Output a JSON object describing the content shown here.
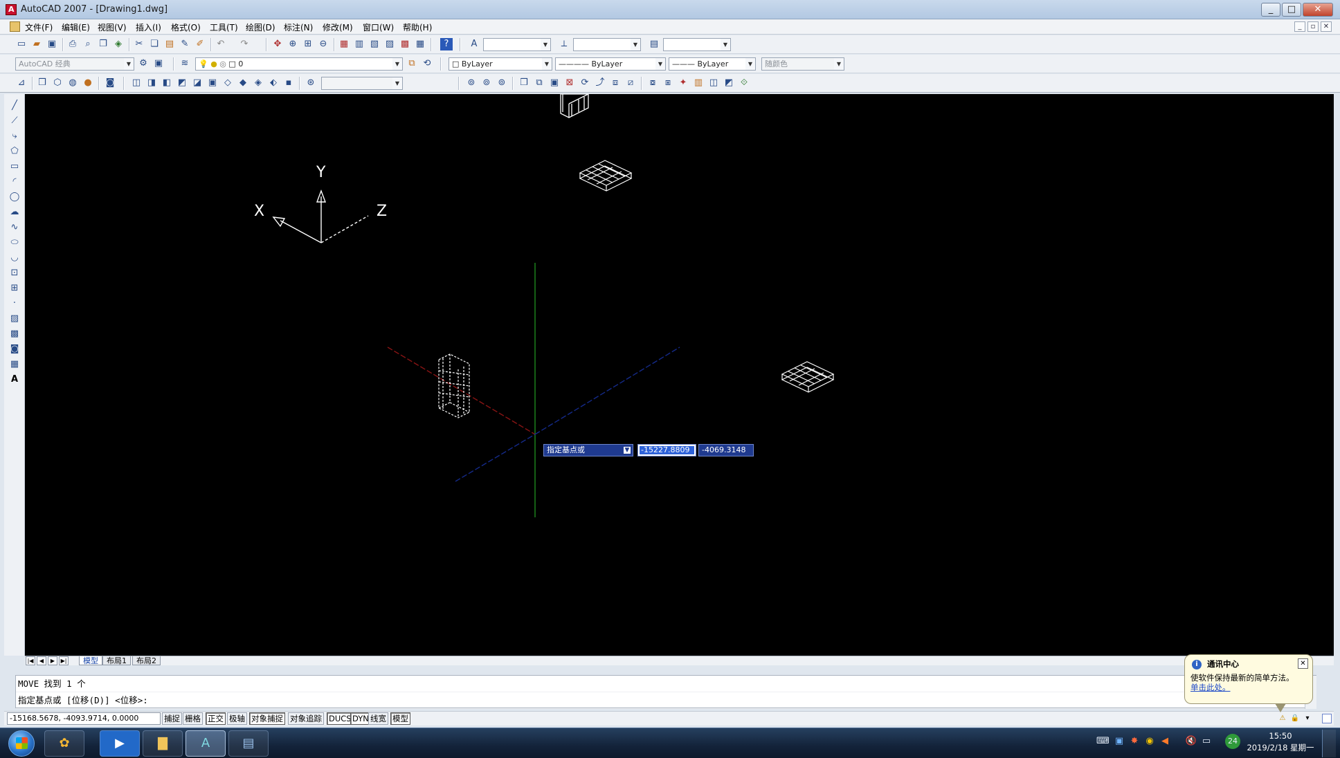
{
  "window": {
    "title": "AutoCAD 2007 - [Drawing1.dwg]",
    "icon": "autocad-logo-icon",
    "controls": [
      "_",
      "□",
      "✕"
    ]
  },
  "menu": {
    "items": [
      "文件(F)",
      "编辑(E)",
      "视图(V)",
      "插入(I)",
      "格式(O)",
      "工具(T)",
      "绘图(D)",
      "标注(N)",
      "修改(M)",
      "窗口(W)",
      "帮助(H)"
    ],
    "doc_controls": [
      "_",
      "▫",
      "✕"
    ]
  },
  "toolbar_standard": {
    "icons": [
      "new-icon",
      "open-icon",
      "save-icon",
      "plot-icon",
      "plot-preview-icon",
      "publish-icon",
      "3d-dwf-icon",
      "cut-icon",
      "copy-icon",
      "paste-icon",
      "match-properties-icon",
      "block-editor-icon",
      "undo-icon",
      "redo-icon",
      "pan-icon",
      "zoom-realtime-icon",
      "zoom-window-icon",
      "zoom-previous-icon",
      "properties-icon",
      "design-center-icon",
      "tool-palettes-icon",
      "sheet-set-icon",
      "markup-icon",
      "quickcalc-icon",
      "help-icon"
    ],
    "text_style_combo": "",
    "dim_style_combo": "",
    "table_style_combo": ""
  },
  "toolbar_props": {
    "workspace": "AutoCAD 经典",
    "layer": "0",
    "color": "ByLayer",
    "linetype": "ByLayer",
    "lineweight": "ByLayer",
    "plot_style": "随颜色"
  },
  "toolbar_3d": {
    "visual_style_combo": ""
  },
  "canvas": {
    "ucs_labels": {
      "x": "X",
      "y": "Y",
      "z": "Z"
    },
    "dynamic_input": {
      "prompt": "指定基点或",
      "x_value": "-15227.8809",
      "y_value": "-4069.3148"
    }
  },
  "layout_tabs": {
    "nav": [
      "|◀",
      "◀",
      "▶",
      "▶|"
    ],
    "tabs": [
      "模型",
      "布局1",
      "布局2"
    ],
    "active": "模型"
  },
  "command_line": {
    "line1": "MOVE 找到 1 个",
    "line2": "指定基点或 [位移(D)] <位移>:"
  },
  "status_bar": {
    "coordinates": "-15168.5678, -4093.9714, 0.0000",
    "toggles": [
      {
        "label": "捕捉",
        "on": false
      },
      {
        "label": "栅格",
        "on": false
      },
      {
        "label": "正交",
        "on": true
      },
      {
        "label": "极轴",
        "on": false
      },
      {
        "label": "对象捕捉",
        "on": true
      },
      {
        "label": "对象追踪",
        "on": false
      },
      {
        "label": "DUCS",
        "on": true
      },
      {
        "label": "DYN",
        "on": true
      },
      {
        "label": "线宽",
        "on": false
      },
      {
        "label": "模型",
        "on": true
      }
    ]
  },
  "notification": {
    "title": "通讯中心",
    "message": "使软件保持最新的简单方法。",
    "link": "单击此处。"
  },
  "taskbar": {
    "apps": [
      "media-player-icon",
      "video-call-icon",
      "file-explorer-icon",
      "autocad-icon",
      "image-viewer-icon"
    ],
    "tray_badge": "24",
    "clock_time": "15:50",
    "clock_date": "2019/2/18 星期一"
  },
  "colors": {
    "canvas_bg": "#000000",
    "selection": "#1f3a8f",
    "input_highlight": "#2e62d9",
    "taskbar": "#1b2f4b"
  }
}
